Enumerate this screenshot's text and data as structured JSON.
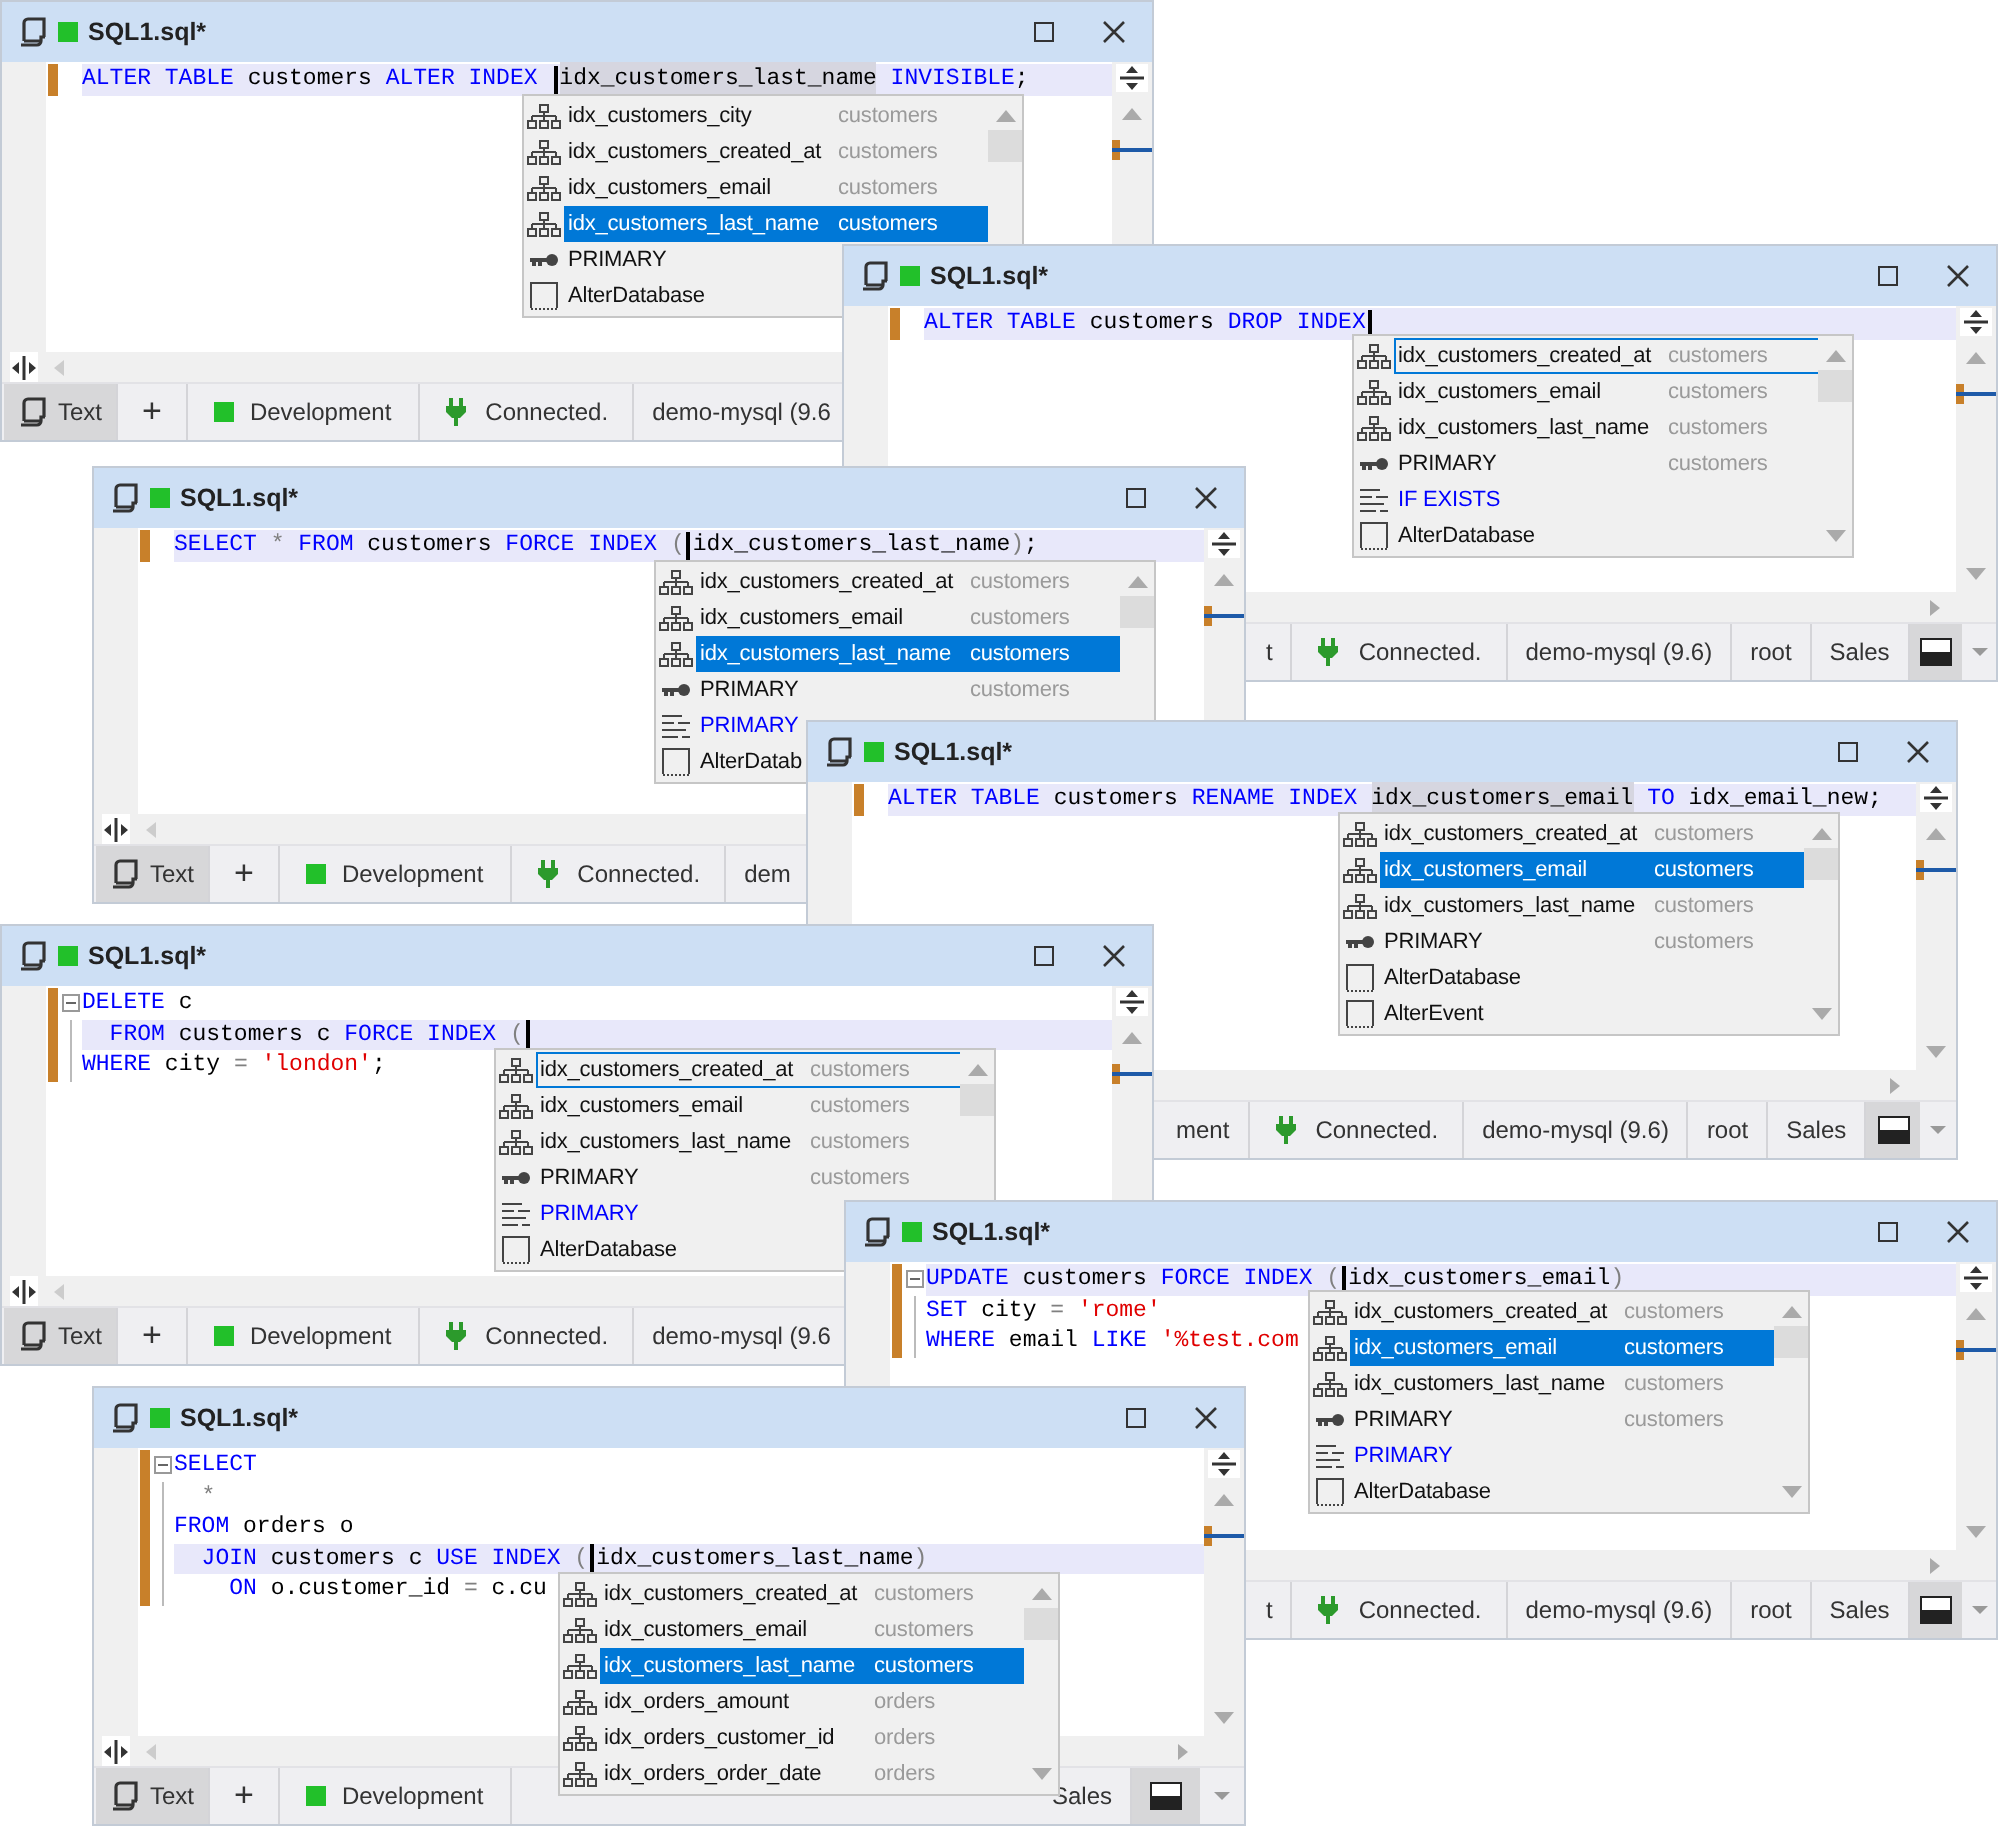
{
  "windows": [
    {
      "title": "SQL1.sql*",
      "folding": false,
      "lines": [
        {
          "current": true,
          "tokens": [
            {
              "kind": "kw",
              "t": "ALTER TABLE"
            },
            {
              "kind": "id",
              "t": " customers "
            },
            {
              "kind": "kw",
              "t": "ALTER INDEX "
            },
            {
              "kind": "caret"
            },
            {
              "kind": "hl",
              "t": "idx_customers_last_name"
            },
            {
              "kind": "kw",
              "t": " INVISIBLE"
            },
            {
              "kind": "id",
              "t": ";"
            }
          ]
        }
      ],
      "popup": [
        {
          "kind": "index",
          "name": "idx_customers_city",
          "table": "customers",
          "selected": false,
          "focused": false
        },
        {
          "kind": "index",
          "name": "idx_customers_created_at",
          "table": "customers",
          "selected": false,
          "focused": false
        },
        {
          "kind": "index",
          "name": "idx_customers_email",
          "table": "customers",
          "selected": false,
          "focused": false
        },
        {
          "kind": "index",
          "name": "idx_customers_last_name",
          "table": "customers",
          "selected": true,
          "focused": false
        },
        {
          "kind": "key",
          "name": "PRIMARY",
          "selected": false,
          "focused": false
        },
        {
          "kind": "object",
          "name": "AlterDatabase",
          "selected": false,
          "focused": false
        }
      ],
      "status": [
        {
          "kind": "mode",
          "text": "Text",
          "selected": true
        },
        {
          "kind": "add",
          "text": "+"
        },
        {
          "kind": "env",
          "text": "Development"
        },
        {
          "kind": "conn",
          "text": "Connected."
        },
        {
          "kind": "info",
          "text": "demo-mysql (9.6"
        }
      ]
    },
    {
      "title": "SQL1.sql*",
      "folding": false,
      "lines": [
        {
          "current": true,
          "tokens": [
            {
              "kind": "kw",
              "t": "ALTER TABLE"
            },
            {
              "kind": "id",
              "t": " customers "
            },
            {
              "kind": "kw",
              "t": "DROP INDEX"
            },
            {
              "kind": "caret"
            }
          ]
        }
      ],
      "popup": [
        {
          "kind": "index",
          "name": "idx_customers_created_at",
          "table": "customers",
          "selected": false,
          "focused": true
        },
        {
          "kind": "index",
          "name": "idx_customers_email",
          "table": "customers",
          "selected": false,
          "focused": false
        },
        {
          "kind": "index",
          "name": "idx_customers_last_name",
          "table": "customers",
          "selected": false,
          "focused": false
        },
        {
          "kind": "key",
          "name": "PRIMARY",
          "table": "customers",
          "selected": false,
          "focused": false
        },
        {
          "kind": "keyword",
          "name": "IF EXISTS",
          "selected": false,
          "focused": false
        },
        {
          "kind": "object",
          "name": "AlterDatabase",
          "selected": false,
          "focused": false
        }
      ],
      "status": [
        {
          "kind": "info",
          "text": "t"
        },
        {
          "kind": "conn",
          "text": "Connected."
        },
        {
          "kind": "info",
          "text": "demo-mysql (9.6)"
        },
        {
          "kind": "info",
          "text": "root"
        },
        {
          "kind": "info",
          "text": "Sales"
        },
        {
          "kind": "panel"
        },
        {
          "kind": "menu"
        }
      ]
    },
    {
      "title": "SQL1.sql*",
      "folding": false,
      "lines": [
        {
          "current": true,
          "tokens": [
            {
              "kind": "kw",
              "t": "SELECT"
            },
            {
              "kind": "op",
              "t": " * "
            },
            {
              "kind": "kw",
              "t": "FROM"
            },
            {
              "kind": "id",
              "t": " customers "
            },
            {
              "kind": "kw",
              "t": "FORCE INDEX "
            },
            {
              "kind": "op",
              "t": "("
            },
            {
              "kind": "caret"
            },
            {
              "kind": "id",
              "t": "idx_customers_last_name"
            },
            {
              "kind": "op",
              "t": ")"
            },
            {
              "kind": "id",
              "t": ";"
            }
          ]
        }
      ],
      "popup": [
        {
          "kind": "index",
          "name": "idx_customers_created_at",
          "table": "customers",
          "selected": false,
          "focused": false
        },
        {
          "kind": "index",
          "name": "idx_customers_email",
          "table": "customers",
          "selected": false,
          "focused": false
        },
        {
          "kind": "index",
          "name": "idx_customers_last_name",
          "table": "customers",
          "selected": true,
          "focused": false
        },
        {
          "kind": "key",
          "name": "PRIMARY",
          "table": "customers",
          "selected": false,
          "focused": false
        },
        {
          "kind": "keyword",
          "name": "PRIMARY",
          "selected": false,
          "focused": false
        },
        {
          "kind": "object",
          "name": "AlterDatab",
          "selected": false,
          "focused": false
        }
      ],
      "status": [
        {
          "kind": "mode",
          "text": "Text",
          "selected": true
        },
        {
          "kind": "add",
          "text": "+"
        },
        {
          "kind": "env",
          "text": "Development"
        },
        {
          "kind": "conn",
          "text": "Connected."
        },
        {
          "kind": "info",
          "text": "dem"
        }
      ]
    },
    {
      "title": "SQL1.sql*",
      "folding": false,
      "lines": [
        {
          "current": true,
          "tokens": [
            {
              "kind": "kw",
              "t": "ALTER TABLE"
            },
            {
              "kind": "id",
              "t": " customers "
            },
            {
              "kind": "kw",
              "t": "RENAME INDEX "
            },
            {
              "kind": "hl",
              "t": "idx_customers_email"
            },
            {
              "kind": "kw",
              "t": " TO"
            },
            {
              "kind": "id",
              "t": " idx_email_new;"
            }
          ]
        }
      ],
      "popup": [
        {
          "kind": "index",
          "name": "idx_customers_created_at",
          "table": "customers",
          "selected": false,
          "focused": false
        },
        {
          "kind": "index",
          "name": "idx_customers_email",
          "table": "customers",
          "selected": true,
          "focused": false
        },
        {
          "kind": "index",
          "name": "idx_customers_last_name",
          "table": "customers",
          "selected": false,
          "focused": false
        },
        {
          "kind": "key",
          "name": "PRIMARY",
          "table": "customers",
          "selected": false,
          "focused": false
        },
        {
          "kind": "object",
          "name": "AlterDatabase",
          "selected": false,
          "focused": false
        },
        {
          "kind": "object",
          "name": "AlterEvent",
          "selected": false,
          "focused": false
        }
      ],
      "status": [
        {
          "kind": "info",
          "text": "ment"
        },
        {
          "kind": "conn",
          "text": "Connected."
        },
        {
          "kind": "info",
          "text": "demo-mysql (9.6)"
        },
        {
          "kind": "info",
          "text": "root"
        },
        {
          "kind": "info",
          "text": "Sales"
        },
        {
          "kind": "panel"
        },
        {
          "kind": "menu"
        }
      ]
    },
    {
      "title": "SQL1.sql*",
      "folding": true,
      "lines": [
        {
          "current": false,
          "tokens": [
            {
              "kind": "kw",
              "t": "DELETE"
            },
            {
              "kind": "id",
              "t": " c"
            }
          ]
        },
        {
          "current": true,
          "tokens": [
            {
              "kind": "kw",
              "t": "  FROM"
            },
            {
              "kind": "id",
              "t": " customers c "
            },
            {
              "kind": "kw",
              "t": "FORCE INDEX "
            },
            {
              "kind": "op",
              "t": "("
            },
            {
              "kind": "caret"
            }
          ]
        },
        {
          "current": false,
          "tokens": [
            {
              "kind": "kw",
              "t": "WHERE"
            },
            {
              "kind": "id",
              "t": " city "
            },
            {
              "kind": "op",
              "t": "= "
            },
            {
              "kind": "str",
              "t": "'london'"
            },
            {
              "kind": "id",
              "t": ";"
            }
          ]
        }
      ],
      "popup": [
        {
          "kind": "index",
          "name": "idx_customers_created_at",
          "table": "customers",
          "selected": false,
          "focused": true
        },
        {
          "kind": "index",
          "name": "idx_customers_email",
          "table": "customers",
          "selected": false,
          "focused": false
        },
        {
          "kind": "index",
          "name": "idx_customers_last_name",
          "table": "customers",
          "selected": false,
          "focused": false
        },
        {
          "kind": "key",
          "name": "PRIMARY",
          "table": "customers",
          "selected": false,
          "focused": false
        },
        {
          "kind": "keyword",
          "name": "PRIMARY",
          "selected": false,
          "focused": false
        },
        {
          "kind": "object",
          "name": "AlterDatabase",
          "selected": false,
          "focused": false
        }
      ],
      "status": [
        {
          "kind": "mode",
          "text": "Text",
          "selected": true
        },
        {
          "kind": "add",
          "text": "+"
        },
        {
          "kind": "env",
          "text": "Development"
        },
        {
          "kind": "conn",
          "text": "Connected."
        },
        {
          "kind": "info",
          "text": "demo-mysql (9.6"
        }
      ]
    },
    {
      "title": "SQL1.sql*",
      "folding": true,
      "lines": [
        {
          "current": true,
          "tokens": [
            {
              "kind": "kw",
              "t": "UPDATE"
            },
            {
              "kind": "id",
              "t": " customers "
            },
            {
              "kind": "kw",
              "t": "FORCE INDEX "
            },
            {
              "kind": "op",
              "t": "("
            },
            {
              "kind": "caret"
            },
            {
              "kind": "id",
              "t": "idx_customers_email"
            },
            {
              "kind": "op",
              "t": ")"
            }
          ]
        },
        {
          "current": false,
          "tokens": [
            {
              "kind": "kw",
              "t": "SET"
            },
            {
              "kind": "id",
              "t": " city "
            },
            {
              "kind": "op",
              "t": "= "
            },
            {
              "kind": "str",
              "t": "'rome'"
            }
          ]
        },
        {
          "current": false,
          "tokens": [
            {
              "kind": "kw",
              "t": "WHERE"
            },
            {
              "kind": "id",
              "t": " email "
            },
            {
              "kind": "kw",
              "t": "LIKE "
            },
            {
              "kind": "str",
              "t": "'%test.com"
            }
          ]
        }
      ],
      "popup": [
        {
          "kind": "index",
          "name": "idx_customers_created_at",
          "table": "customers",
          "selected": false,
          "focused": false
        },
        {
          "kind": "index",
          "name": "idx_customers_email",
          "table": "customers",
          "selected": true,
          "focused": false
        },
        {
          "kind": "index",
          "name": "idx_customers_last_name",
          "table": "customers",
          "selected": false,
          "focused": false
        },
        {
          "kind": "key",
          "name": "PRIMARY",
          "table": "customers",
          "selected": false,
          "focused": false
        },
        {
          "kind": "keyword",
          "name": "PRIMARY",
          "selected": false,
          "focused": false
        },
        {
          "kind": "object",
          "name": "AlterDatabase",
          "selected": false,
          "focused": false
        }
      ],
      "status": [
        {
          "kind": "info",
          "text": "t"
        },
        {
          "kind": "conn",
          "text": "Connected."
        },
        {
          "kind": "info",
          "text": "demo-mysql (9.6)"
        },
        {
          "kind": "info",
          "text": "root"
        },
        {
          "kind": "info",
          "text": "Sales"
        },
        {
          "kind": "panel"
        },
        {
          "kind": "menu"
        }
      ]
    },
    {
      "title": "SQL1.sql*",
      "folding": true,
      "lines": [
        {
          "current": false,
          "tokens": [
            {
              "kind": "kw",
              "t": "SELECT"
            }
          ]
        },
        {
          "current": false,
          "tokens": [
            {
              "kind": "op",
              "t": "  *"
            }
          ]
        },
        {
          "current": false,
          "tokens": [
            {
              "kind": "kw",
              "t": "FROM"
            },
            {
              "kind": "id",
              "t": " orders o"
            }
          ]
        },
        {
          "current": true,
          "tokens": [
            {
              "kind": "kw",
              "t": "  JOIN"
            },
            {
              "kind": "id",
              "t": " customers c "
            },
            {
              "kind": "kw",
              "t": "USE INDEX "
            },
            {
              "kind": "op",
              "t": "("
            },
            {
              "kind": "caret"
            },
            {
              "kind": "id",
              "t": "idx_customers_last_name"
            },
            {
              "kind": "op",
              "t": ")"
            }
          ]
        },
        {
          "current": false,
          "tokens": [
            {
              "kind": "kw",
              "t": "    ON"
            },
            {
              "kind": "id",
              "t": " o.customer_id "
            },
            {
              "kind": "op",
              "t": "="
            },
            {
              "kind": "id",
              "t": " c.cu"
            }
          ]
        }
      ],
      "popup": [
        {
          "kind": "index",
          "name": "idx_customers_created_at",
          "table": "customers",
          "selected": false,
          "focused": false
        },
        {
          "kind": "index",
          "name": "idx_customers_email",
          "table": "customers",
          "selected": false,
          "focused": false
        },
        {
          "kind": "index",
          "name": "idx_customers_last_name",
          "table": "customers",
          "selected": true,
          "focused": false
        },
        {
          "kind": "index",
          "name": "idx_orders_amount",
          "table": "orders",
          "selected": false,
          "focused": false
        },
        {
          "kind": "index",
          "name": "idx_orders_customer_id",
          "table": "orders",
          "selected": false,
          "focused": false
        },
        {
          "kind": "index",
          "name": "idx_orders_order_date",
          "table": "orders",
          "selected": false,
          "focused": false
        }
      ],
      "status": [
        {
          "kind": "mode",
          "text": "Text",
          "selected": true
        },
        {
          "kind": "add",
          "text": "+"
        },
        {
          "kind": "env",
          "text": "Development"
        },
        {
          "kind": "info",
          "text": "Sales"
        },
        {
          "kind": "panel"
        },
        {
          "kind": "menu"
        }
      ]
    }
  ]
}
